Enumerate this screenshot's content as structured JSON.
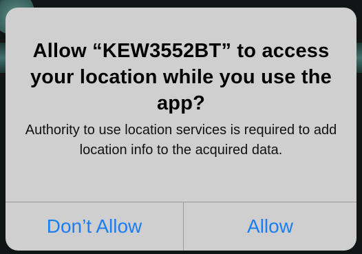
{
  "alert": {
    "title": "Allow “KEW3552BT” to access your location while you use the app?",
    "message": "Authority to use location services is required to add location info to the acquired data.",
    "buttons": {
      "dont_allow": "Don’t Allow",
      "allow": "Allow"
    }
  },
  "colors": {
    "dialog_background": "#cfcfcf",
    "button_text": "#1a7ef2",
    "separator": "#9a9a9a",
    "backdrop": "#111516"
  }
}
